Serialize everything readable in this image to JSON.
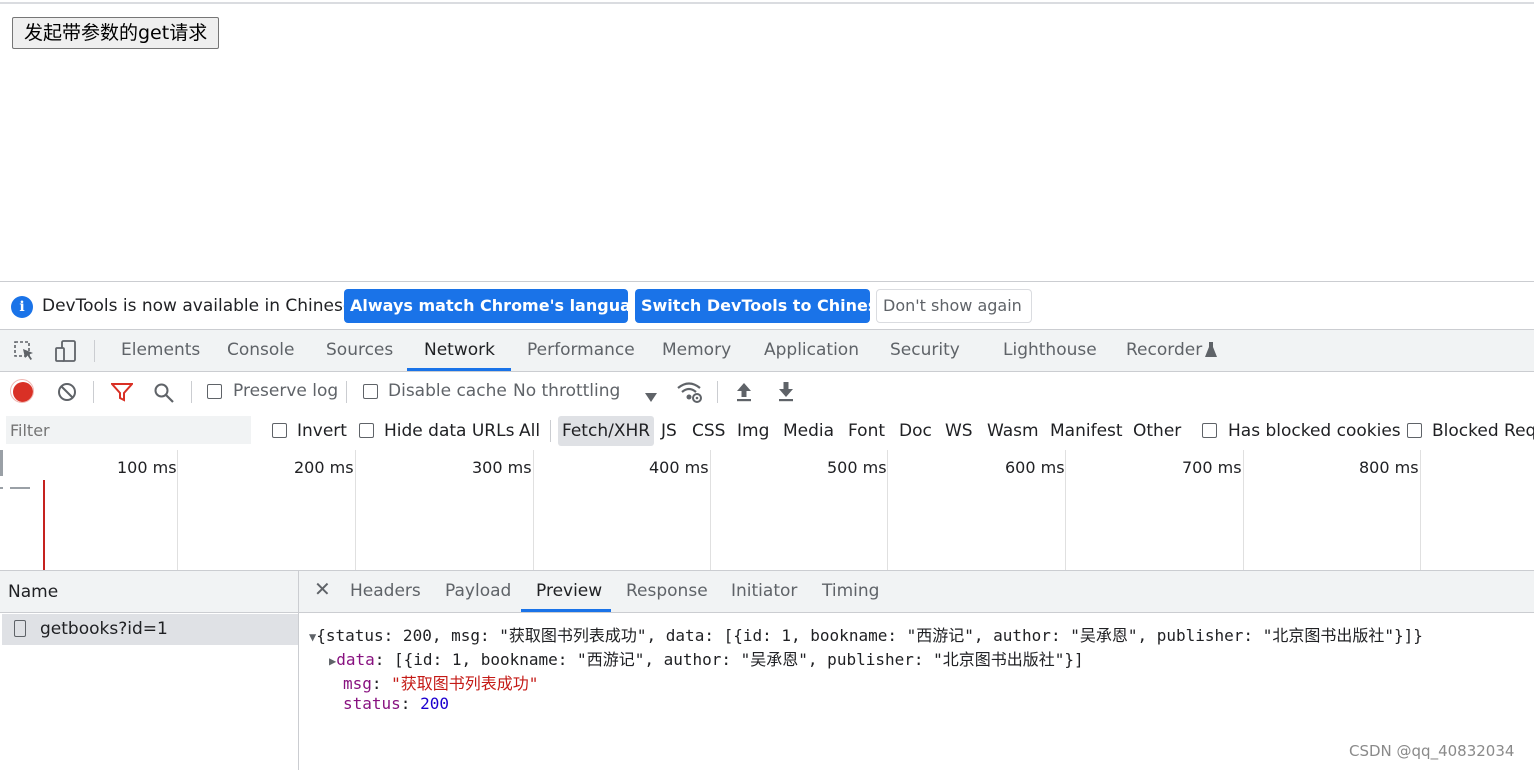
{
  "page": {
    "button_label": "发起带参数的get请求"
  },
  "infobar": {
    "message": "DevTools is now available in Chinese!",
    "btn_match": "Always match Chrome's language",
    "btn_switch": "Switch DevTools to Chinese",
    "btn_dismiss": "Don't show again"
  },
  "tabs": [
    "Elements",
    "Console",
    "Sources",
    "Network",
    "Performance",
    "Memory",
    "Application",
    "Security",
    "Lighthouse",
    "Recorder"
  ],
  "network_toolbar": {
    "preserve_log": "Preserve log",
    "disable_cache": "Disable cache",
    "throttling": "No throttling"
  },
  "filter_bar": {
    "placeholder": "Filter",
    "invert": "Invert",
    "hide_data_urls": "Hide data URLs",
    "types": [
      "All",
      "Fetch/XHR",
      "JS",
      "CSS",
      "Img",
      "Media",
      "Font",
      "Doc",
      "WS",
      "Wasm",
      "Manifest",
      "Other"
    ],
    "active_type": "Fetch/XHR",
    "has_blocked_cookies": "Has blocked cookies",
    "blocked_requests": "Blocked Requ"
  },
  "timeline": {
    "ticks": [
      "100 ms",
      "200 ms",
      "300 ms",
      "400 ms",
      "500 ms",
      "600 ms",
      "700 ms",
      "800 ms"
    ]
  },
  "requests": {
    "header": "Name",
    "rows": [
      "getbooks?id=1"
    ]
  },
  "detail_tabs": [
    "Headers",
    "Payload",
    "Preview",
    "Response",
    "Initiator",
    "Timing"
  ],
  "preview": {
    "summary": "{status: 200, msg: \"获取图书列表成功\", data: [{id: 1, bookname: \"西游记\", author: \"吴承恩\", publisher: \"北京图书出版社\"}]}",
    "data_key": "data",
    "data_value": "[{id: 1, bookname: \"西游记\", author: \"吴承恩\", publisher: \"北京图书出版社\"}]",
    "msg_key": "msg",
    "msg_value": "\"获取图书列表成功\"",
    "status_key": "status",
    "status_value": "200"
  },
  "watermark": "CSDN @qq_40832034",
  "colors": {
    "accent": "#1a73e8",
    "record": "#d93025",
    "key": "#881280",
    "string": "#c41a16",
    "number": "#1c00cf"
  }
}
